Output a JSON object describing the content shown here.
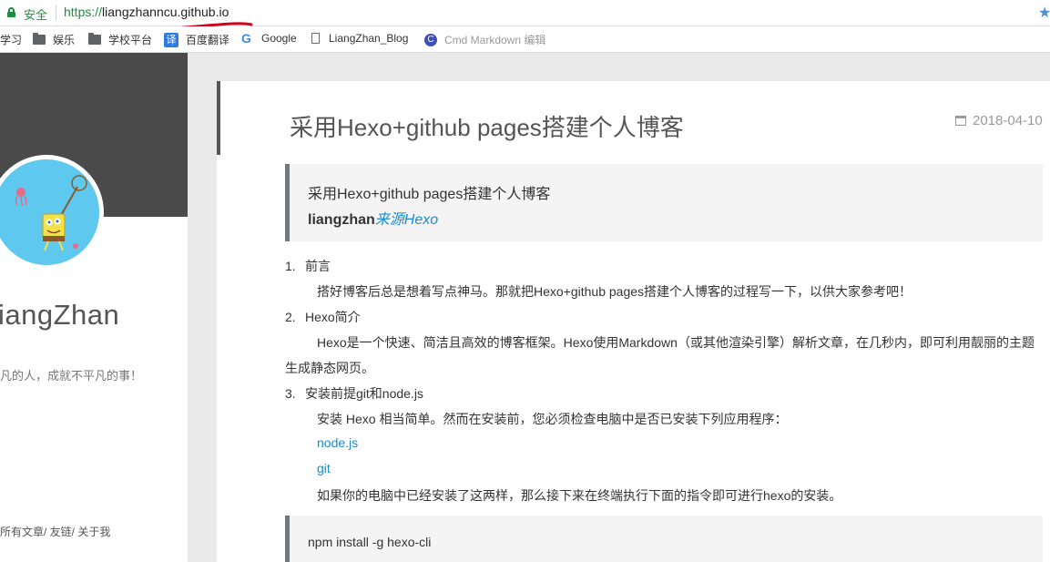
{
  "address_bar": {
    "secure_label": "安全",
    "url_scheme": "https://",
    "url_rest": "liangzhanncu.github.io"
  },
  "bookmarks": [
    {
      "label": "学习",
      "icon": "folder-icon"
    },
    {
      "label": "娱乐",
      "icon": "folder-icon"
    },
    {
      "label": "学校平台",
      "icon": "folder-icon"
    },
    {
      "label": "百度翻译",
      "icon": "translate-icon",
      "icon_text": "译"
    },
    {
      "label": "Google",
      "icon": "google-icon",
      "icon_text": "G"
    },
    {
      "label": "LiangZhan_Blog",
      "icon": "page-icon"
    },
    {
      "label": "Cmd Markdown 编辑",
      "icon": "cmd-markdown-icon",
      "icon_text": "C"
    }
  ],
  "sidebar": {
    "author_name": "iangZhan",
    "motto": "凡的人，成就不平凡的事！",
    "links": "所有文章/ 友链/ 关于我"
  },
  "article": {
    "title": "采用Hexo+github pages搭建个人博客",
    "date": "2018-04-10",
    "quote_line1": "采用Hexo+github pages搭建个人博客",
    "quote_author": "liangzhan",
    "quote_source": "来源Hexo",
    "sections": [
      {
        "num": "1.",
        "heading": "前言"
      },
      {
        "num": "2.",
        "heading": "Hexo简介"
      },
      {
        "num": "3.",
        "heading": "安装前提git和node.js"
      }
    ],
    "p_intro": "搭好博客后总是想着写点神马。那就把Hexo+github pages搭建个人博客的过程写一下，以供大家参考吧！",
    "p_hexo_line1": "Hexo是一个快速、简洁且高效的博客框架。Hexo使用Markdown（或其他渲染引擎）解析文章，在几秒内，即可利用靓丽的主题",
    "p_hexo_line2": "生成静态网页。",
    "p_install": "安装 Hexo 相当简单。然而在安装前，您必须检查电脑中是否已安装下列应用程序：",
    "link_node": "node.js",
    "link_git": "git",
    "p_after": "如果你的电脑中已经安装了这两样，那么接下来在终端执行下面的指令即可进行hexo的安装。",
    "code": "npm install -g hexo-cli"
  },
  "colors": {
    "secure_green": "#1e8e3e",
    "link_blue": "#1a8ccc",
    "annotation_red": "#d0021b"
  }
}
